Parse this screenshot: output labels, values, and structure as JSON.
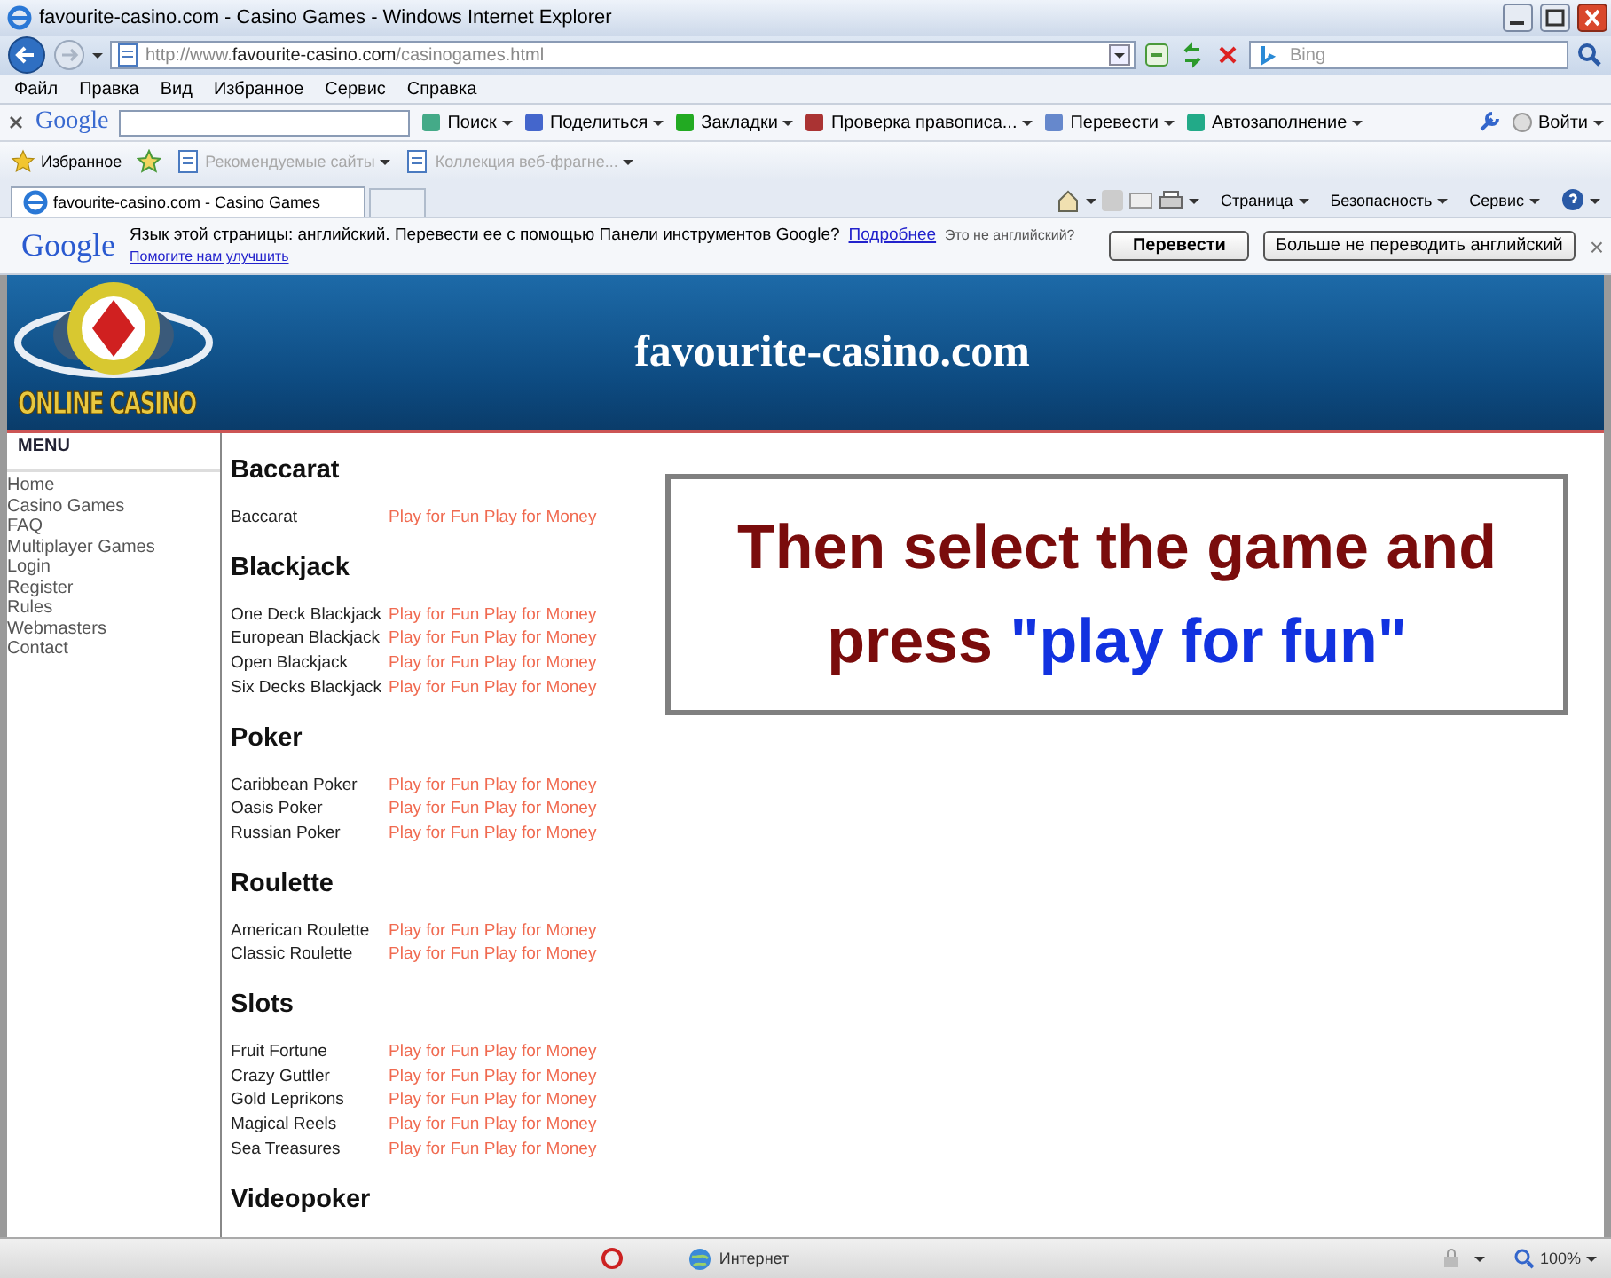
{
  "window": {
    "title": "favourite-casino.com - Casino Games - Windows Internet Explorer"
  },
  "address_bar": {
    "url_parts": [
      {
        "text": "http://www.",
        "emphasis": false
      },
      {
        "text": "favourite-casino.com",
        "emphasis": true
      },
      {
        "text": "/casinogames.html",
        "emphasis": false
      }
    ],
    "search": {
      "placeholder": "Bing"
    }
  },
  "menu_bar": [
    "Файл",
    "Правка",
    "Вид",
    "Избранное",
    "Сервис",
    "Справка"
  ],
  "google_toolbar": {
    "logo": "Google",
    "items": [
      "Поиск",
      "Поделиться",
      "Закладки",
      "Проверка правописа...",
      "Перевести",
      "Автозаполнение"
    ],
    "sign_in": "Войти"
  },
  "favorites_bar": {
    "label": "Избранное",
    "items": [
      {
        "label": "Рекомендуемые сайты",
        "disabled": true
      },
      {
        "label": "Коллекция веб-фрагне...",
        "disabled": true
      }
    ]
  },
  "tabs": [
    {
      "label": "favourite-casino.com - Casino Games",
      "selected": true
    }
  ],
  "command_bar": [
    "Страница",
    "Безопасность",
    "Сервис"
  ],
  "translate_bar": {
    "logo": "Google",
    "message": "Язык этой страницы: английский. Перевести ее с помощью Панели инструментов Google?",
    "more_link": "Подробнее",
    "not_english": "Это не английский?",
    "help_link": "Помогите нам улучшить",
    "buttons": [
      "Перевести",
      "Больше не переводить английский"
    ],
    "close": "×"
  },
  "site": {
    "logo_text": "ONLINE CASINO",
    "title": "favourite-casino.com",
    "menu_title": "MENU",
    "menu_items": [
      "Home",
      "Casino Games",
      "FAQ",
      "Multiplayer Games",
      "Login",
      "Register",
      "Rules",
      "Webmasters",
      "Contact"
    ],
    "sections": [
      {
        "title": "Baccarat",
        "games": [
          {
            "name": "Baccarat",
            "links": [
              "Play for Fun",
              "Play for Money"
            ]
          }
        ]
      },
      {
        "title": "Blackjack",
        "games": [
          {
            "name": "One Deck Blackjack",
            "links": [
              "Play for Fun",
              "Play for Money"
            ]
          },
          {
            "name": "European Blackjack",
            "links": [
              "Play for Fun",
              "Play for Money"
            ]
          },
          {
            "name": "Open Blackjack",
            "links": [
              "Play for Fun",
              "Play for Money"
            ]
          },
          {
            "name": "Six Decks Blackjack",
            "links": [
              "Play for Fun",
              "Play for Money"
            ]
          }
        ]
      },
      {
        "title": "Poker",
        "games": [
          {
            "name": "Caribbean Poker",
            "links": [
              "Play for Fun",
              "Play for Money"
            ]
          },
          {
            "name": "Oasis Poker",
            "links": [
              "Play for Fun",
              "Play for Money"
            ]
          },
          {
            "name": "Russian Poker",
            "links": [
              "Play for Fun",
              "Play for Money"
            ]
          }
        ]
      },
      {
        "title": "Roulette",
        "games": [
          {
            "name": "American Roulette",
            "links": [
              "Play for Fun",
              "Play for Money"
            ]
          },
          {
            "name": "Classic Roulette",
            "links": [
              "Play for Fun",
              "Play for Money"
            ]
          }
        ]
      },
      {
        "title": "Slots",
        "games": [
          {
            "name": "Fruit Fortune",
            "links": [
              "Play for Fun",
              "Play for Money"
            ]
          },
          {
            "name": "Crazy Guttler",
            "links": [
              "Play for Fun",
              "Play for Money"
            ]
          },
          {
            "name": "Gold Leprikons",
            "links": [
              "Play for Fun",
              "Play for Money"
            ]
          },
          {
            "name": "Magical Reels",
            "links": [
              "Play for Fun",
              "Play for Money"
            ]
          },
          {
            "name": "Sea Treasures",
            "links": [
              "Play for Fun",
              "Play for Money"
            ]
          }
        ]
      },
      {
        "title": "Videopoker"
      }
    ],
    "caption": [
      {
        "text": "Then select the game and press ",
        "highlight": false
      },
      {
        "text": "\"play for fun\"",
        "highlight": true
      }
    ]
  },
  "status_bar": {
    "zone": "Интернет",
    "zoom": "100%"
  }
}
